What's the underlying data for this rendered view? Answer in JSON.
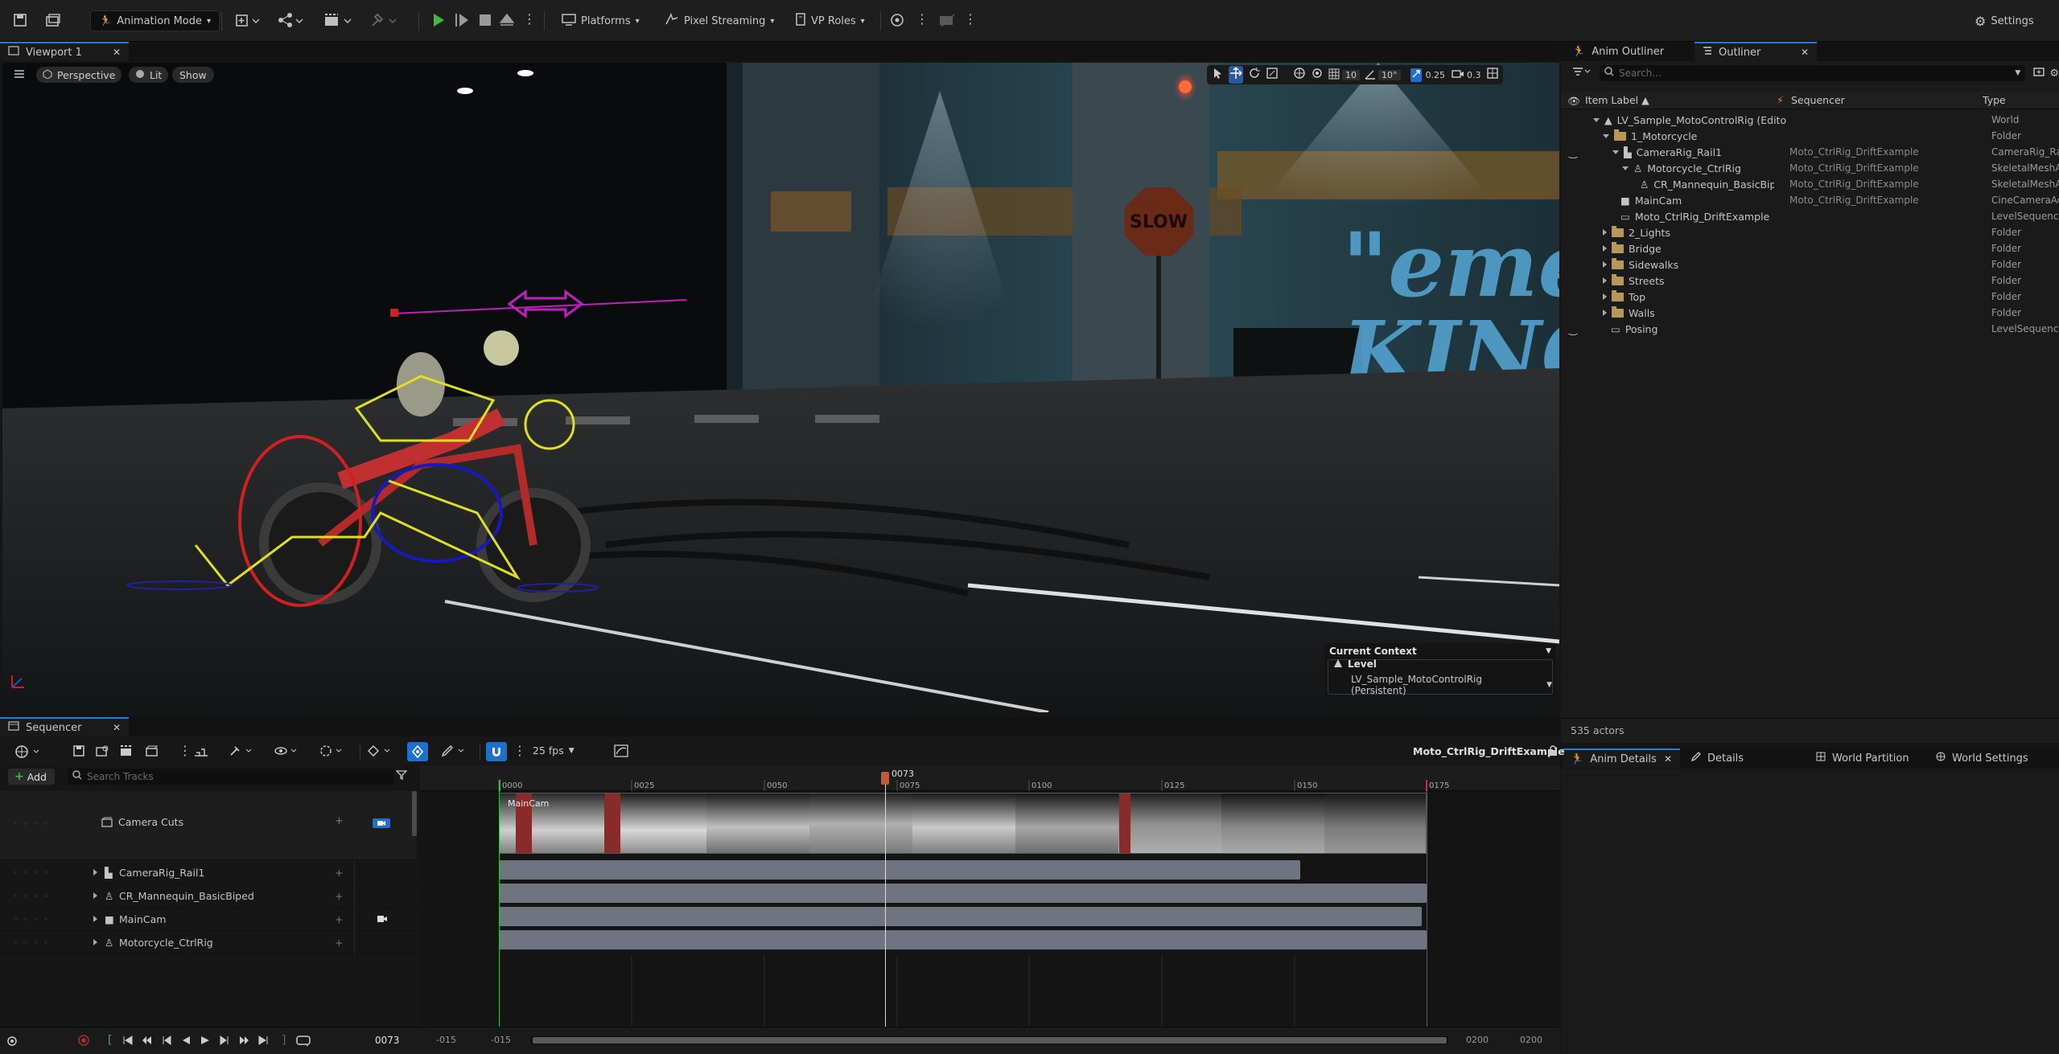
{
  "toolbar": {
    "mode_label": "Animation Mode",
    "platforms_label": "Platforms",
    "pixel_streaming_label": "Pixel Streaming",
    "vp_roles_label": "VP Roles",
    "settings_label": "Settings"
  },
  "viewport": {
    "tab_label": "Viewport 1",
    "perspective_label": "Perspective",
    "lit_label": "Lit",
    "show_label": "Show",
    "grid_snap": "10",
    "rot_snap": "10°",
    "scale_snap": "0.25",
    "camera_speed": "0.3",
    "context": {
      "title": "Current Context",
      "level_label": "Level",
      "level_value": "LV_Sample_MotoControlRig (Persistent)"
    }
  },
  "outliner": {
    "tabs": [
      "Anim Outliner",
      "Outliner"
    ],
    "search_placeholder": "Search...",
    "columns": {
      "label": "Item Label ▲",
      "sequencer": "Sequencer",
      "type": "Type"
    },
    "rows": [
      {
        "label": "LV_Sample_MotoControlRig (Edito",
        "seq": "",
        "type": "World"
      },
      {
        "label": "1_Motorcycle",
        "seq": "",
        "type": "Folder"
      },
      {
        "label": "CameraRig_Rail1",
        "seq": "Moto_CtrlRig_DriftExample",
        "type": "CameraRig_Rai"
      },
      {
        "label": "Motorcycle_CtrlRig",
        "seq": "Moto_CtrlRig_DriftExample",
        "type": "SkeletalMeshA"
      },
      {
        "label": "CR_Mannequin_BasicBipe",
        "seq": "Moto_CtrlRig_DriftExample",
        "type": "SkeletalMeshA"
      },
      {
        "label": "MainCam",
        "seq": "Moto_CtrlRig_DriftExample",
        "type": "CineCameraAc"
      },
      {
        "label": "Moto_CtrlRig_DriftExample",
        "seq": "",
        "type": "LevelSequence"
      },
      {
        "label": "2_Lights",
        "seq": "",
        "type": "Folder"
      },
      {
        "label": "Bridge",
        "seq": "",
        "type": "Folder"
      },
      {
        "label": "Sidewalks",
        "seq": "",
        "type": "Folder"
      },
      {
        "label": "Streets",
        "seq": "",
        "type": "Folder"
      },
      {
        "label": "Top",
        "seq": "",
        "type": "Folder"
      },
      {
        "label": "Walls",
        "seq": "",
        "type": "Folder"
      },
      {
        "label": "Posing",
        "seq": "",
        "type": "LevelSequence"
      }
    ],
    "actor_count": "535 actors"
  },
  "details": {
    "tabs": [
      "Anim Details",
      "Details",
      "World Partition",
      "World Settings"
    ]
  },
  "sequencer": {
    "tab_label": "Sequencer",
    "fps_label": "25 fps",
    "sequence_name": "Moto_CtrlRig_DriftExample",
    "add_label": "Add",
    "search_placeholder": "Search Tracks",
    "tracks": [
      "Camera Cuts",
      "CameraRig_Rail1",
      "CR_Mannequin_BasicBiped",
      "MainCam",
      "Motorcycle_CtrlRig"
    ],
    "ruler_ticks": [
      "0000",
      "0025",
      "0050",
      "0075",
      "0100",
      "0125",
      "0150",
      "0175"
    ],
    "playhead_frame": "0073",
    "current_frame": "0073",
    "range_start_a": "-015",
    "range_start_b": "-015",
    "range_end_a": "0200",
    "range_end_b": "0200",
    "camera_clip_label": "MainCam"
  },
  "viewport_scene": {
    "graffiti": "\"eme\nKING",
    "sign": "SLOW"
  }
}
